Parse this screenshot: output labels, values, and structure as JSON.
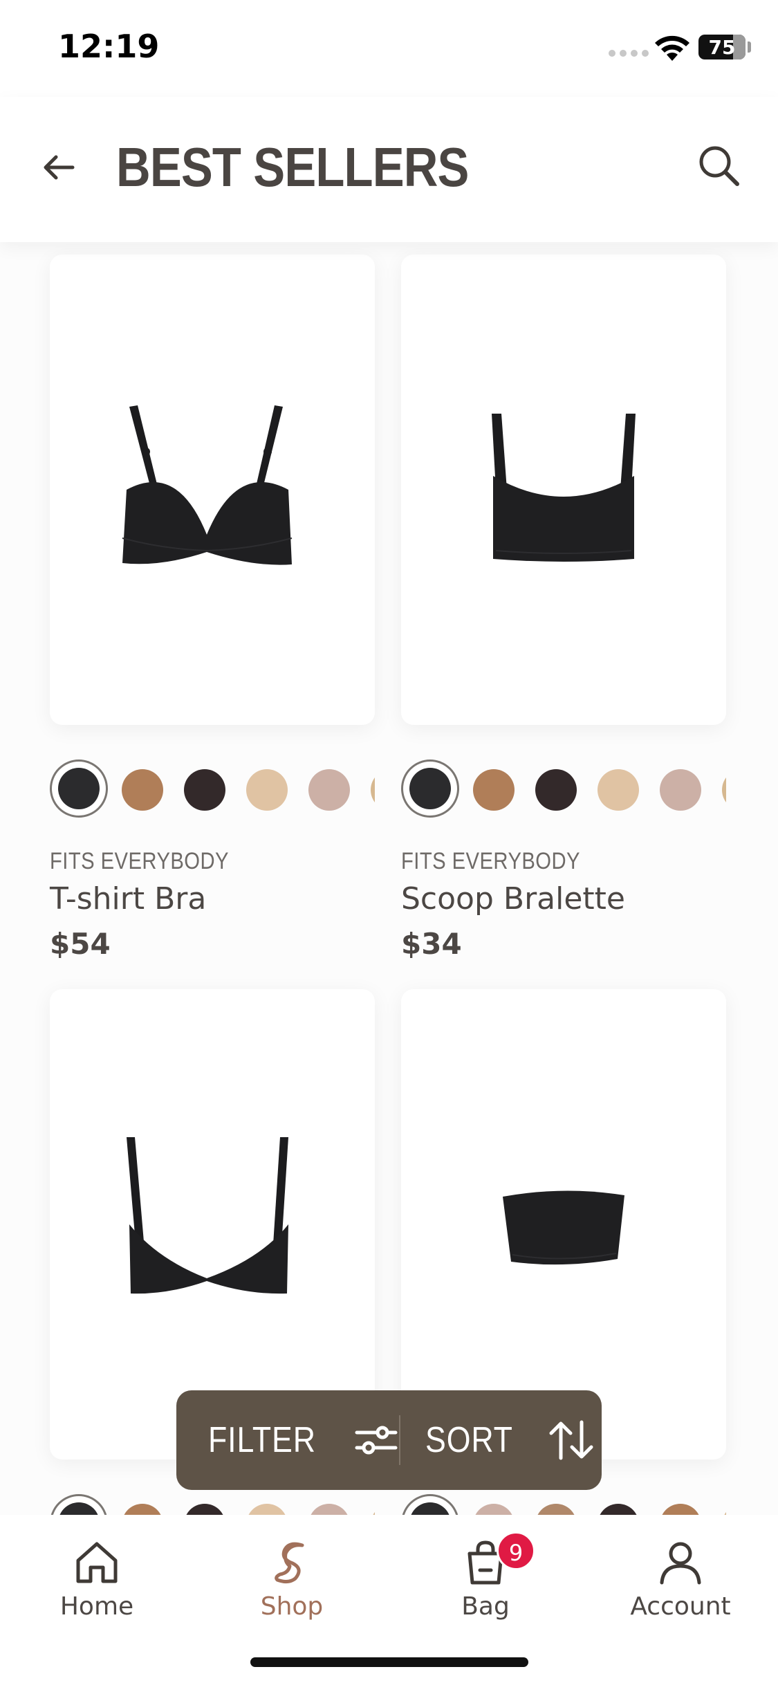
{
  "status_bar": {
    "time": "12:19",
    "battery": "75"
  },
  "header": {
    "title": "BEST SELLERS"
  },
  "products": [
    {
      "brand": "FITS EVERYBODY",
      "name": "T-shirt Bra",
      "price": "$54",
      "swatches": [
        "#2b2b2d",
        "#b07e58",
        "#33292a",
        "#e0c3a3",
        "#ccb0a6",
        "#d6b890"
      ]
    },
    {
      "brand": "FITS EVERYBODY",
      "name": "Scoop Bralette",
      "price": "$34",
      "swatches": [
        "#2b2b2d",
        "#b07e58",
        "#33292a",
        "#e0c3a3",
        "#ccb0a6",
        "#d6b890"
      ]
    },
    {
      "swatches": [
        "#2b2b2d",
        "#b07e58",
        "#33292a",
        "#e0c3a3",
        "#ccb0a6",
        "#d6b890"
      ]
    },
    {
      "swatches": [
        "#2b2b2d",
        "#ccb0a6",
        "#b0886a",
        "#33292a",
        "#b07e58",
        "#d6b890"
      ]
    }
  ],
  "toolbar": {
    "filter_label": "FILTER",
    "sort_label": "SORT"
  },
  "tabs": [
    {
      "label": "Home",
      "icon": "home-icon"
    },
    {
      "label": "Shop",
      "icon": "shop-logo-icon",
      "active": true
    },
    {
      "label": "Bag",
      "icon": "bag-icon",
      "badge": "9"
    },
    {
      "label": "Account",
      "icon": "account-icon"
    }
  ],
  "colors": {
    "accent": "#a1705a",
    "pill": "#5e5347",
    "badge": "#e01a44"
  }
}
